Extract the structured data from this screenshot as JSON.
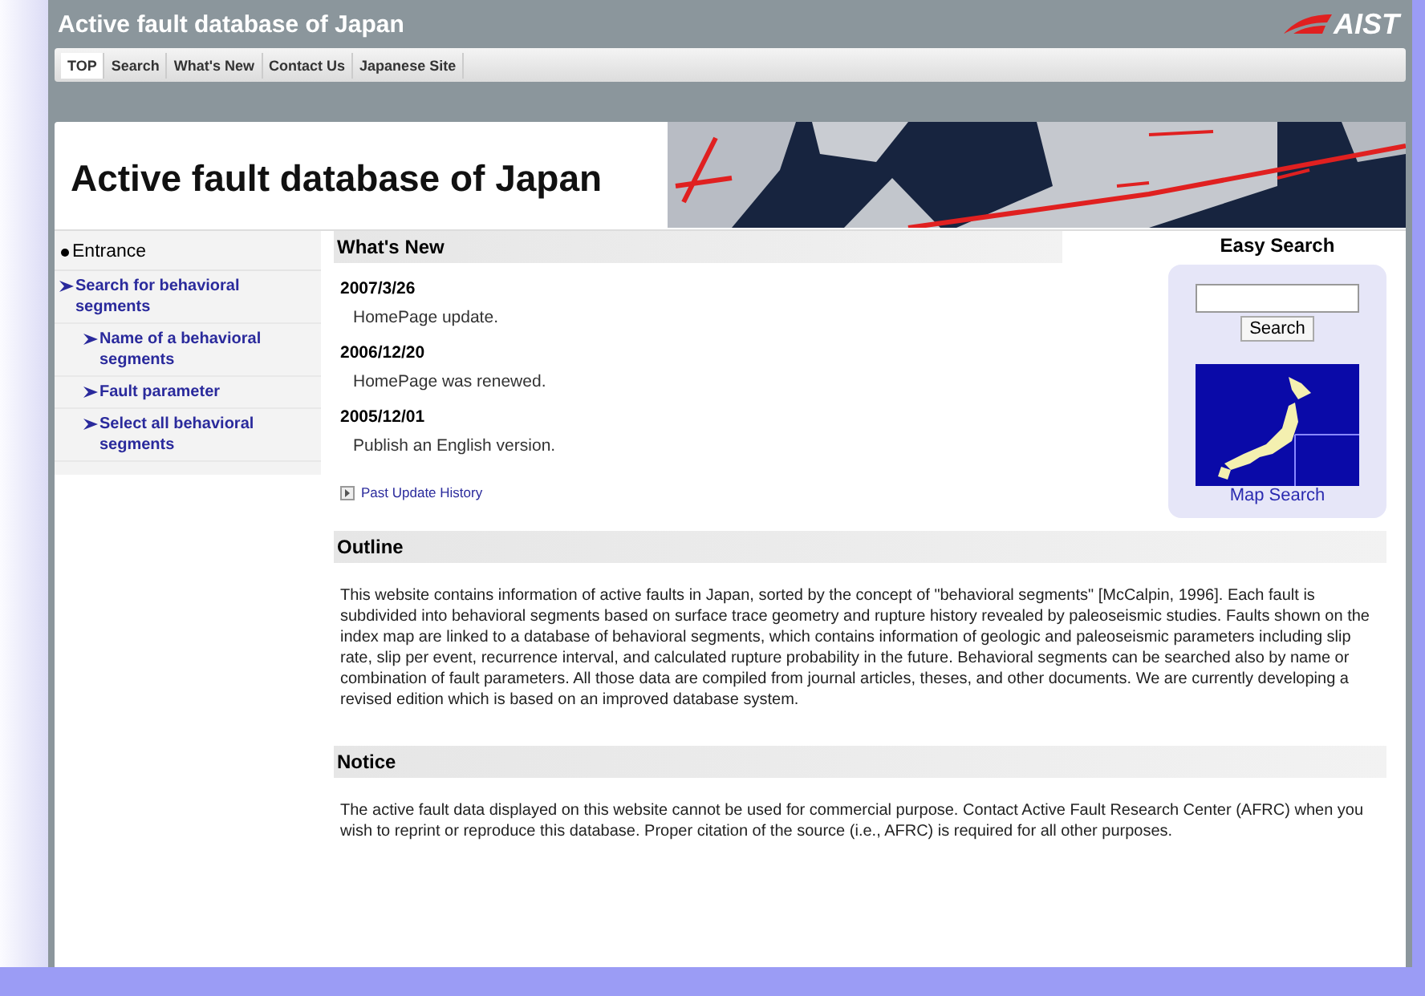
{
  "site_title": "Active fault database of Japan",
  "logo": "AIST",
  "nav": [
    {
      "label": "TOP",
      "selected": true
    },
    {
      "label": "Search",
      "selected": false
    },
    {
      "label": "What's New",
      "selected": false
    },
    {
      "label": "Contact Us",
      "selected": false
    },
    {
      "label": "Japanese Site",
      "selected": false
    }
  ],
  "banner_title": "Active fault database of Japan",
  "sidebar": {
    "heading": "Entrance",
    "items": [
      {
        "label": "Search for behavioral segments",
        "children": [
          {
            "label": "Name of a behavioral segments"
          },
          {
            "label": "Fault parameter"
          },
          {
            "label": "Select all behavioral segments"
          }
        ]
      }
    ]
  },
  "whats_new": {
    "heading": "What's New",
    "entries": [
      {
        "date": "2007/3/26",
        "text": "HomePage update."
      },
      {
        "date": "2006/12/20",
        "text": "HomePage was renewed."
      },
      {
        "date": "2005/12/01",
        "text": "Publish an English version."
      }
    ],
    "history_link": "Past Update History"
  },
  "easy_search": {
    "heading": "Easy Search",
    "button": "Search",
    "map_link": "Map Search"
  },
  "sections": [
    {
      "heading": "Outline",
      "text": "This website contains information of active faults in Japan, sorted by the concept of \"behavioral segments\" [McCalpin, 1996]. Each fault is subdivided into behavioral segments based on surface trace geometry and rupture history revealed by paleoseismic studies. Faults shown on the index map are linked to a database of behavioral segments, which contains information of geologic and paleoseismic parameters including slip rate, slip per event, recurrence interval, and calculated rupture probability in the future. Behavioral segments can be searched also by name or combination of fault parameters. All those data are compiled from journal articles, theses, and other documents. We are currently developing a revised edition which is based on an improved database system."
    },
    {
      "heading": "Notice",
      "text": "The active fault data displayed on this website cannot be used for commercial purpose. Contact Active Fault Research Center (AFRC) when you wish to reprint or reproduce this database. Proper citation of the source (i.e., AFRC) is required for all other purposes."
    }
  ]
}
